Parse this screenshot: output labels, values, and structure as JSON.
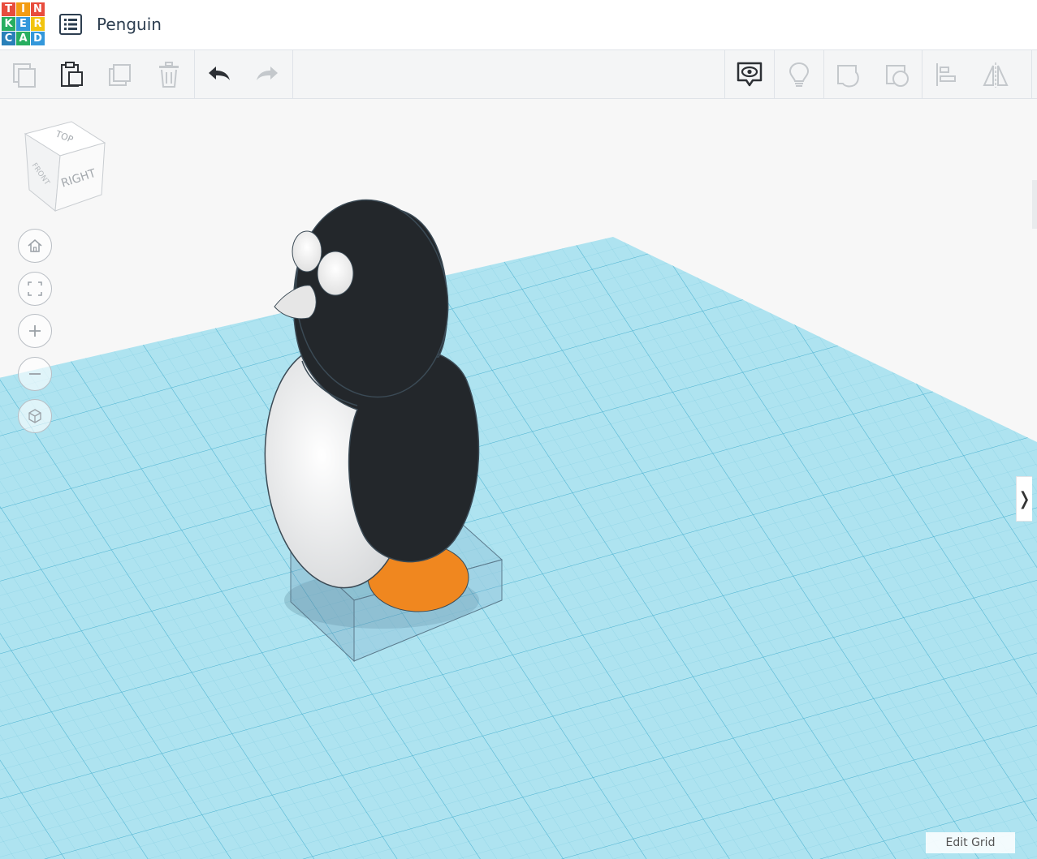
{
  "header": {
    "logo_letters": [
      "T",
      "I",
      "N",
      "K",
      "E",
      "R",
      "C",
      "A",
      "D"
    ],
    "logo_colors": [
      "#e84c3d",
      "#f39c12",
      "#e84c3d",
      "#27ae60",
      "#3498db",
      "#f1c40f",
      "#2980b9",
      "#27ae60",
      "#3498db"
    ],
    "menu_icon": "list-icon",
    "title": "Penguin"
  },
  "toolbar": {
    "left_group": [
      "copy-icon",
      "paste-icon",
      "duplicate-icon",
      "delete-icon"
    ],
    "history_group": [
      "undo-icon",
      "redo-icon"
    ],
    "right_group": [
      "notes-visibility-icon",
      "lightbulb-icon",
      "solid-shape-icon",
      "hole-shape-icon",
      "align-icon",
      "mirror-icon"
    ]
  },
  "viewcube": {
    "top_label": "TOP",
    "front_label": "FRONT",
    "right_label": "RIGHT"
  },
  "nav_controls": [
    "home-icon",
    "fit-view-icon",
    "zoom-in-icon",
    "zoom-out-icon",
    "orthographic-icon"
  ],
  "viewport": {
    "grid_color": "#aee3f0",
    "grid_line_color": "#6cc3dc",
    "penguin_body_color": "#23272b",
    "penguin_belly_color": "#eeeeee",
    "penguin_feet_color": "#f0871f"
  },
  "right_panel_toggle": "❭",
  "edit_grid_label": "Edit Grid"
}
